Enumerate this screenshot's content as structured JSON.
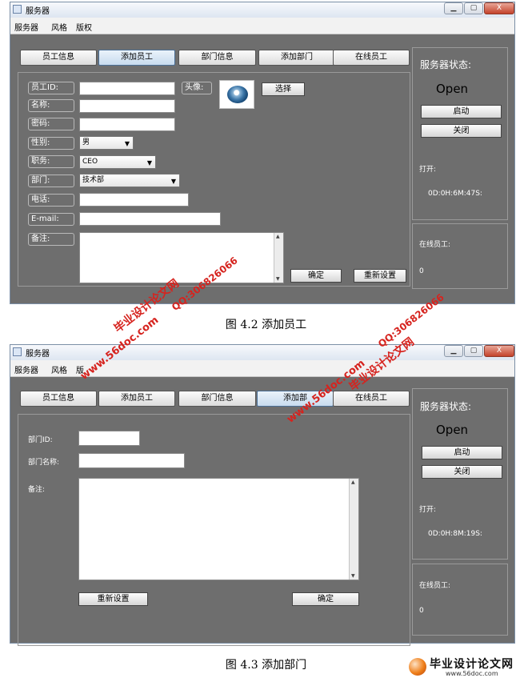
{
  "window1": {
    "title": "服务器",
    "min_icon": "▁",
    "max_icon": "▢",
    "close_icon": "X",
    "menu": [
      "服务器",
      "风格",
      "版权"
    ],
    "tabs": [
      "员工信息",
      "添加员工",
      "部门信息",
      "添加部门",
      "在线员工"
    ],
    "selected_tab": 1,
    "form": {
      "labels": {
        "id": "员工ID:",
        "name": "名称:",
        "password": "密码:",
        "gender": "性别:",
        "position": "职务:",
        "department": "部门:",
        "phone": "电话:",
        "email": "E-mail:",
        "remark": "备注:",
        "avatar": "头像:"
      },
      "gender_value": "男",
      "position_value": "CEO",
      "department_value": "技术部",
      "choose_button": "选择",
      "confirm_button": "确定",
      "reset_button": "重新设置"
    },
    "status": {
      "title": "服务器状态:",
      "state": "Open",
      "start_button": "启动",
      "stop_button": "关闭",
      "uptime_label": "打开:",
      "uptime_value": "0D:0H:6M:47S:",
      "online_label": "在线员工:",
      "online_count": "0"
    }
  },
  "caption1": "图 4.2  添加员工",
  "window2": {
    "title": "服务器",
    "min_icon": "▁",
    "max_icon": "▢",
    "close_icon": "X",
    "menu": [
      "服务器",
      "风格",
      "版"
    ],
    "tabs": [
      "员工信息",
      "添加员工",
      "部门信息",
      "添加部",
      "在线员工"
    ],
    "selected_tab": 3,
    "form": {
      "labels": {
        "id": "部门ID:",
        "name": "部门名称:",
        "remark": "备注:"
      },
      "reset_button": "重新设置",
      "confirm_button": "确定"
    },
    "status": {
      "title": "服务器状态:",
      "state": "Open",
      "start_button": "启动",
      "stop_button": "关闭",
      "uptime_label": "打开:",
      "uptime_value": "0D:0H:8M:19S:",
      "online_label": "在线员工:",
      "online_count": "0"
    }
  },
  "caption2": "图 4.3 添加部门",
  "watermarks": {
    "site_name": "毕业设计论文网",
    "url": "www.56doc.com",
    "qq": "QQ:306826066"
  },
  "logo": {
    "text": "毕业设计论文网",
    "url": "www.56doc.com"
  },
  "colors": {
    "window_bg": "#6e6e6e",
    "selected_tab": "#c8dbee",
    "watermark": "#d6231e"
  }
}
